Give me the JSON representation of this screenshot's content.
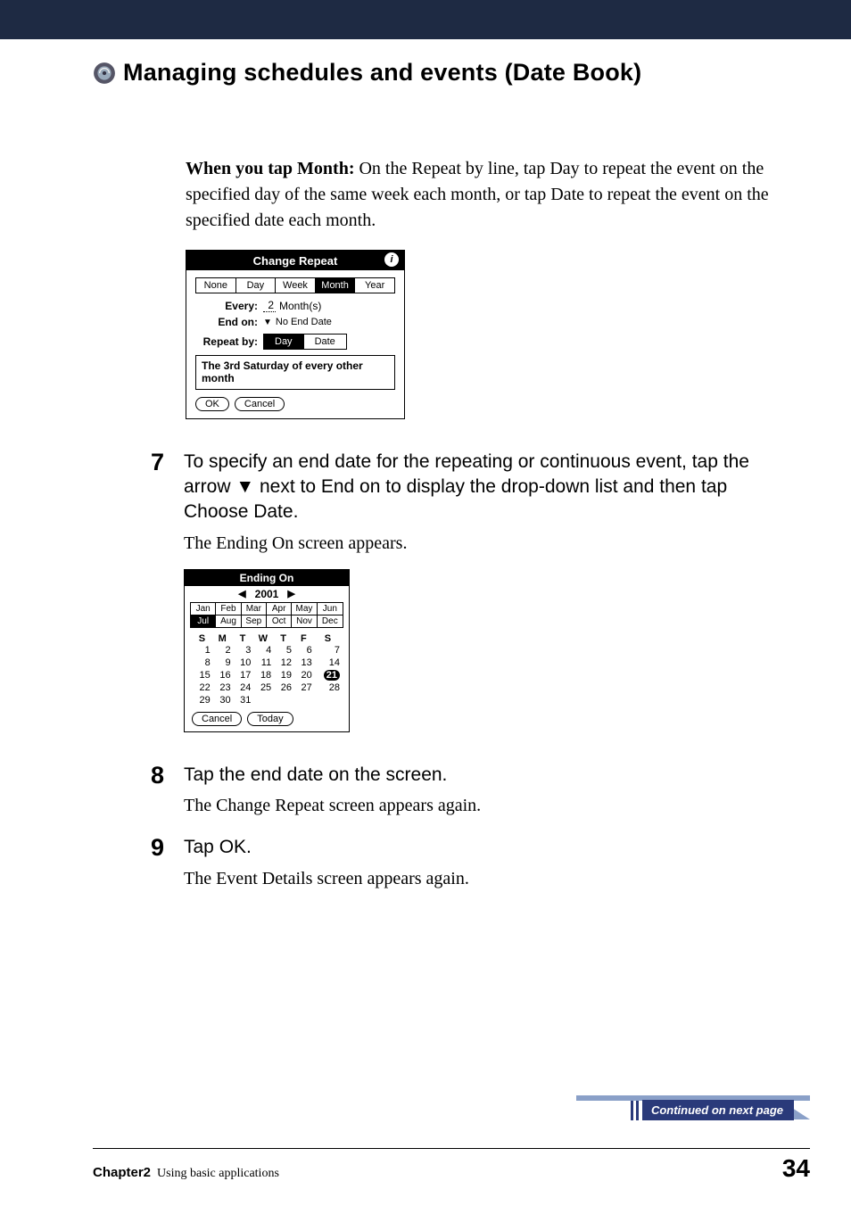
{
  "heading": "Managing schedules and events (Date Book)",
  "intro": {
    "lead_bold": "When you tap Month:",
    "rest": " On the Repeat by line, tap Day to repeat the event on the specified day of the same week each month, or tap Date to repeat the event on the specified date each month."
  },
  "change_repeat": {
    "title": "Change Repeat",
    "info_glyph": "i",
    "tabs": [
      "None",
      "Day",
      "Week",
      "Month",
      "Year"
    ],
    "tabs_selected": "Month",
    "every_label": "Every:",
    "every_value": "2",
    "every_unit": "Month(s)",
    "endon_label": "End on:",
    "endon_value": "No End Date",
    "repeatby_label": "Repeat by:",
    "repeatby_options": [
      "Day",
      "Date"
    ],
    "repeatby_selected": "Day",
    "summary": "The 3rd Saturday of every other month",
    "ok": "OK",
    "cancel": "Cancel"
  },
  "step7": {
    "num": "7",
    "instr": "To specify an end date for the repeating or continuous event, tap the arrow ▼ next to End on to display the drop-down list and then tap Choose Date.",
    "follow": "The Ending On screen appears."
  },
  "ending_on": {
    "title": "Ending On",
    "prev": "◀",
    "year": "2001",
    "next": "▶",
    "months": [
      "Jan",
      "Feb",
      "Mar",
      "Apr",
      "May",
      "Jun",
      "Jul",
      "Aug",
      "Sep",
      "Oct",
      "Nov",
      "Dec"
    ],
    "month_selected": "Jul",
    "dow": [
      "S",
      "M",
      "T",
      "W",
      "T",
      "F",
      "S"
    ],
    "weeks": [
      [
        "1",
        "2",
        "3",
        "4",
        "5",
        "6",
        "7"
      ],
      [
        "8",
        "9",
        "10",
        "11",
        "12",
        "13",
        "14"
      ],
      [
        "15",
        "16",
        "17",
        "18",
        "19",
        "20",
        "21"
      ],
      [
        "22",
        "23",
        "24",
        "25",
        "26",
        "27",
        "28"
      ],
      [
        "29",
        "30",
        "31",
        "",
        "",
        "",
        ""
      ]
    ],
    "selected_day": "21",
    "cancel": "Cancel",
    "today": "Today"
  },
  "step8": {
    "num": "8",
    "instr": "Tap the end date on the screen.",
    "follow": "The Change Repeat screen appears again."
  },
  "step9": {
    "num": "9",
    "instr": "Tap OK.",
    "follow": "The Event Details screen appears again."
  },
  "continued": "Continued on next page",
  "footer": {
    "chapter": "Chapter2",
    "chapter_title": "Using basic applications",
    "page": "34"
  }
}
